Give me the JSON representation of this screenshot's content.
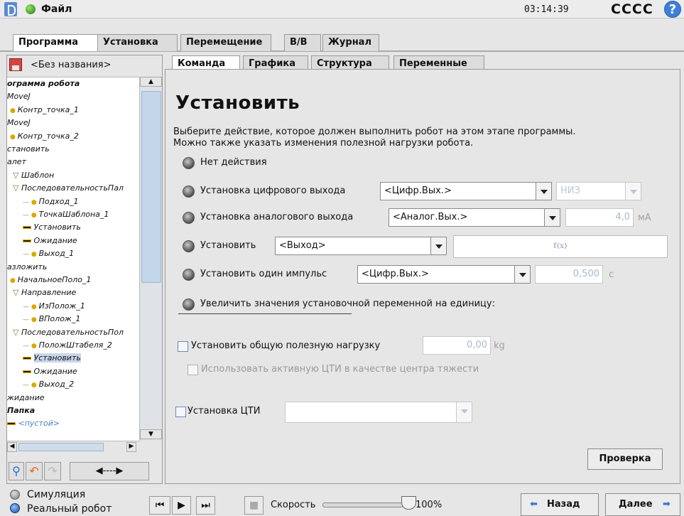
{
  "titlebar": {
    "file_menu": "Файл",
    "clock": "03:14:39",
    "robot_name": "CCCC"
  },
  "main_tabs": [
    {
      "label": "Программа",
      "active": true
    },
    {
      "label": "Установка",
      "active": false
    },
    {
      "label": "Перемещение",
      "active": false
    },
    {
      "label": "В/В",
      "active": false
    },
    {
      "label": "Журнал",
      "active": false
    }
  ],
  "program": {
    "name": "<Без названия>",
    "tree": [
      {
        "label": "ограмма робота",
        "bold": true
      },
      {
        "label": "MoveJ"
      },
      {
        "label": "Контр_точка_1"
      },
      {
        "label": "MoveJ"
      },
      {
        "label": "Контр_точка_2"
      },
      {
        "label": "становить"
      },
      {
        "label": "алет"
      },
      {
        "label": "Шаблон"
      },
      {
        "label": "ПоследовательностьПал"
      },
      {
        "label": "Подход_1"
      },
      {
        "label": "ТочкаШаблона_1"
      },
      {
        "label": "Установить"
      },
      {
        "label": "Ожидание"
      },
      {
        "label": "Выход_1"
      },
      {
        "label": "азложить"
      },
      {
        "label": "НачальноеПоло_1"
      },
      {
        "label": "Направление"
      },
      {
        "label": "ИзПолож_1"
      },
      {
        "label": "ВПолож_1"
      },
      {
        "label": "ПоследовательностьПол"
      },
      {
        "label": "ПоложШтабеля_2"
      },
      {
        "label": "Установить",
        "selected": true
      },
      {
        "label": "Ожидание"
      },
      {
        "label": "Выход_2"
      },
      {
        "label": "жидание"
      },
      {
        "label": "Папка",
        "bold": true
      },
      {
        "label": "<пустой>"
      }
    ]
  },
  "sub_tabs": [
    {
      "label": "Команда",
      "active": true
    },
    {
      "label": "Графика",
      "active": false
    },
    {
      "label": "Структура",
      "active": false
    },
    {
      "label": "Переменные",
      "active": false
    }
  ],
  "command": {
    "title": "Установить",
    "description_line1": "Выберите действие, которое должен выполнить робот на этом этапе программы.",
    "description_line2": "Можно также указать изменения полезной нагрузки робота.",
    "options": {
      "no_action": "Нет действия",
      "digital_out": "Установка цифрового выхода",
      "analog_out": "Установка аналогового выхода",
      "set": "Установить",
      "single_pulse": "Установить один импульс",
      "increment": "Увеличить значения установочной переменной на единицу:"
    },
    "digital_select": "<Цифр.Вых.>",
    "digital_level": "НИЗ",
    "analog_select": "<Аналог.Вых.>",
    "analog_value": "4,0",
    "analog_unit": "мА",
    "output_select": "<Выход>",
    "expression_label": "f(x)",
    "pulse_select": "<Цифр.Вых.>",
    "pulse_value": "0,500",
    "pulse_unit": "с",
    "payload_label": "Установить общую полезную нагрузку",
    "payload_value": "0,00",
    "payload_unit": "kg",
    "tcp_cog_label": "Использовать активную ЦТИ в качестве центра тяжести",
    "tcp_label": "Установка ЦТИ",
    "check_button": "Проверка"
  },
  "bottom": {
    "simulation": "Симуляция",
    "real_robot": "Реальный робот",
    "speed_label": "Скорость",
    "speed_value": "100%",
    "speed_fraction": 1.0,
    "back": "Назад",
    "next": "Далее"
  }
}
